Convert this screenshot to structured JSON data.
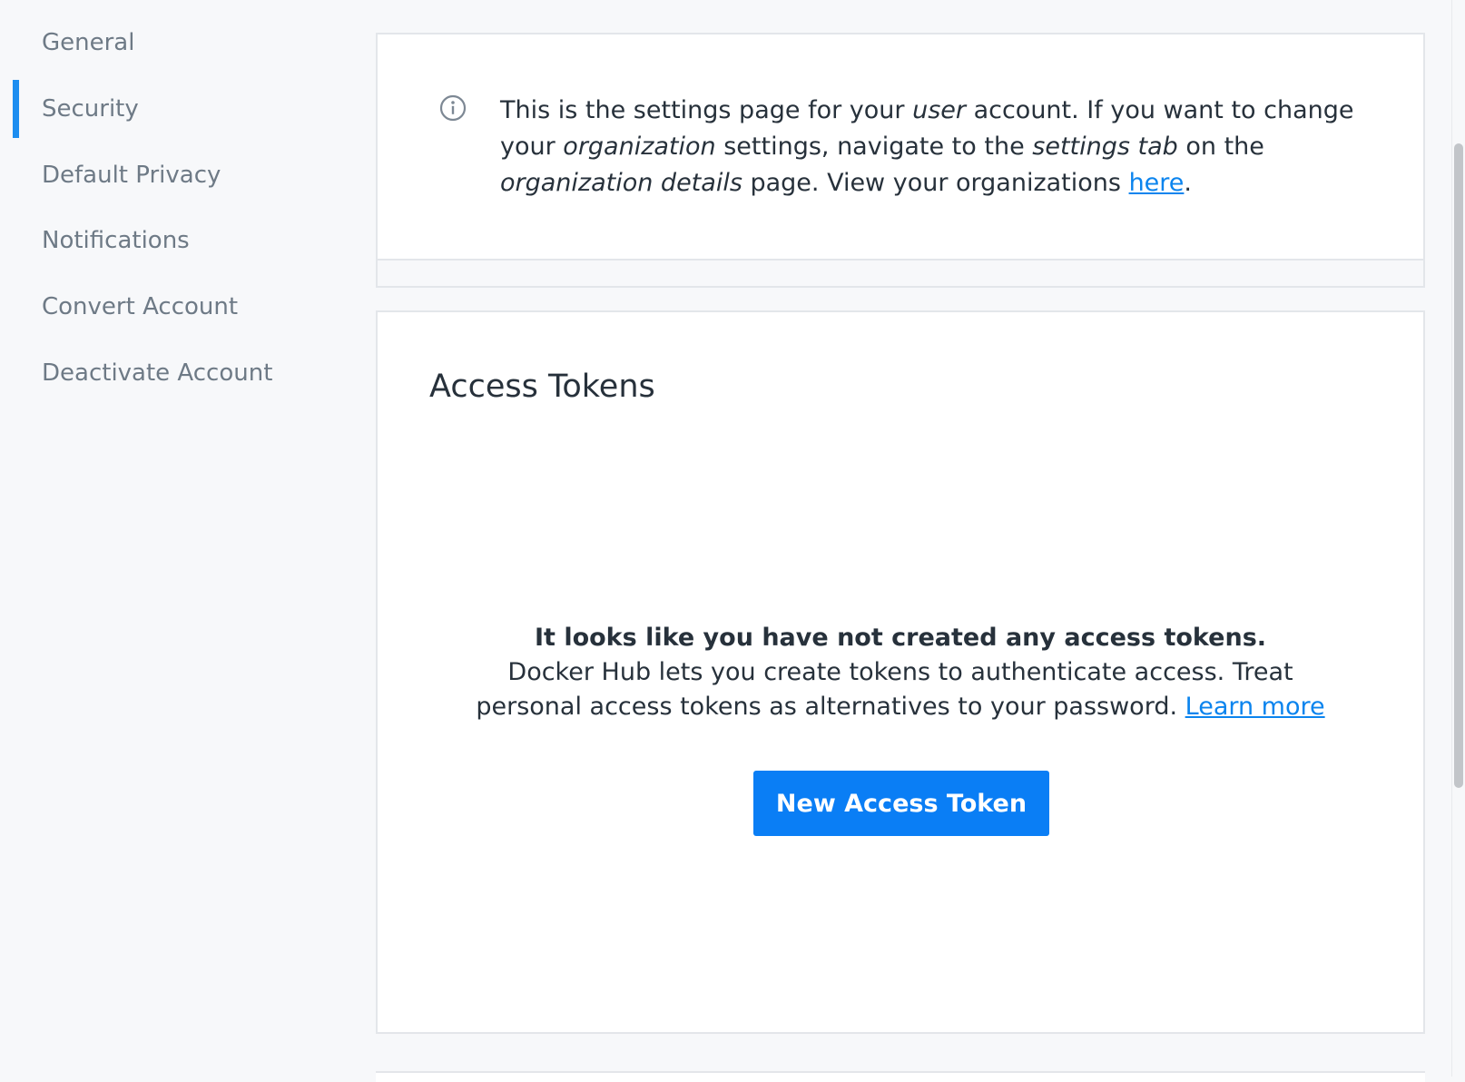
{
  "sidebar": {
    "items": [
      {
        "label": "General"
      },
      {
        "label": "Security",
        "active": true
      },
      {
        "label": "Default Privacy"
      },
      {
        "label": "Notifications"
      },
      {
        "label": "Convert Account"
      },
      {
        "label": "Deactivate Account"
      }
    ],
    "active_color": "#1d8ef0"
  },
  "info": {
    "icon": "info-icon",
    "text_1": "This is the settings page for your ",
    "em_user": "user",
    "text_2": " account. If you want to change your ",
    "em_organization": "organization",
    "text_3": " settings, navigate to the ",
    "em_settings_tab": "settings tab",
    "text_4": " on the ",
    "em_org_details": "organization details",
    "text_5": " page. View your organizations ",
    "link_here": "here",
    "text_6": "."
  },
  "tokens": {
    "title": "Access Tokens",
    "empty_heading": "It looks like you have not created any access tokens.",
    "empty_desc": "Docker Hub lets you create tokens to authenticate access. Treat personal access tokens as alternatives to your password. ",
    "learn_more": "Learn more",
    "new_button": "New Access Token",
    "button_color": "#0a7ef5"
  }
}
